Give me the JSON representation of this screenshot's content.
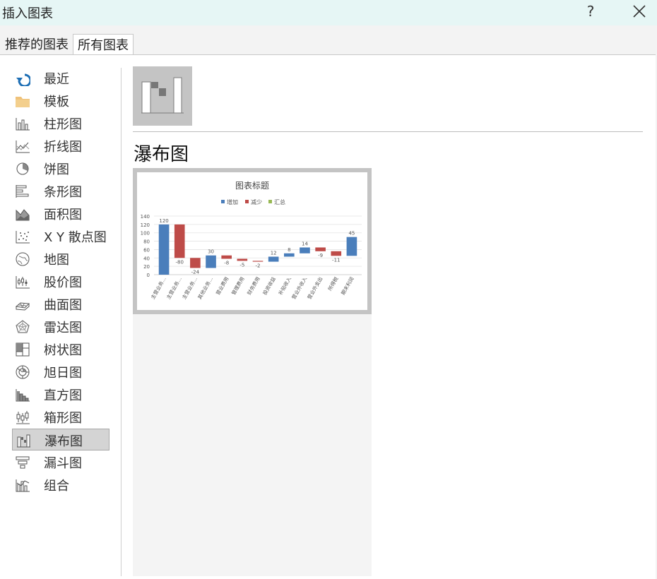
{
  "window": {
    "title": "插入图表",
    "help_label": "?"
  },
  "tabs": [
    {
      "label": "推荐的图表",
      "active": false
    },
    {
      "label": "所有图表",
      "active": true
    }
  ],
  "sidebar": {
    "items": [
      {
        "label": "最近",
        "icon": "recent-icon"
      },
      {
        "label": "模板",
        "icon": "template-folder-icon"
      },
      {
        "label": "柱形图",
        "icon": "column-chart-icon"
      },
      {
        "label": "折线图",
        "icon": "line-chart-icon"
      },
      {
        "label": "饼图",
        "icon": "pie-chart-icon"
      },
      {
        "label": "条形图",
        "icon": "bar-chart-icon"
      },
      {
        "label": "面积图",
        "icon": "area-chart-icon"
      },
      {
        "label": "X Y 散点图",
        "icon": "scatter-chart-icon"
      },
      {
        "label": "地图",
        "icon": "map-chart-icon"
      },
      {
        "label": "股价图",
        "icon": "stock-chart-icon"
      },
      {
        "label": "曲面图",
        "icon": "surface-chart-icon"
      },
      {
        "label": "雷达图",
        "icon": "radar-chart-icon"
      },
      {
        "label": "树状图",
        "icon": "treemap-chart-icon"
      },
      {
        "label": "旭日图",
        "icon": "sunburst-chart-icon"
      },
      {
        "label": "直方图",
        "icon": "histogram-chart-icon"
      },
      {
        "label": "箱形图",
        "icon": "box-whisker-chart-icon"
      },
      {
        "label": "瀑布图",
        "icon": "waterfall-chart-icon"
      },
      {
        "label": "漏斗图",
        "icon": "funnel-chart-icon"
      },
      {
        "label": "组合",
        "icon": "combo-chart-icon"
      }
    ],
    "selected_index": 16
  },
  "main": {
    "type_title": "瀑布图"
  },
  "colors": {
    "increase": "#4a7ebb",
    "decrease": "#be4b48",
    "total": "#98b954",
    "accent_icon": "#1e6fb5"
  },
  "chart_data": {
    "type": "bar",
    "title": "图表标题",
    "legend": [
      "增加",
      "减少",
      "汇总"
    ],
    "legend_position": "top",
    "ylim": [
      0,
      140
    ],
    "yticks": [
      0,
      20,
      40,
      60,
      80,
      100,
      120,
      140
    ],
    "grid": true,
    "categories": [
      "主营业务…",
      "主营业务…",
      "主营业务…",
      "其他业务…",
      "营业费用",
      "管理费用",
      "财务费用",
      "投资收益",
      "补贴收入",
      "营业外收入",
      "营业外支出",
      "所得税",
      "期末利润"
    ],
    "values": [
      120,
      -80,
      -24,
      30,
      -8,
      -5,
      -2,
      12,
      8,
      14,
      -9,
      -11,
      45
    ],
    "labels": [
      "120",
      "-80",
      "-24",
      "30",
      "-8",
      "-5",
      "-2",
      "12",
      "8",
      "14",
      "-9",
      "-11",
      "45"
    ]
  }
}
